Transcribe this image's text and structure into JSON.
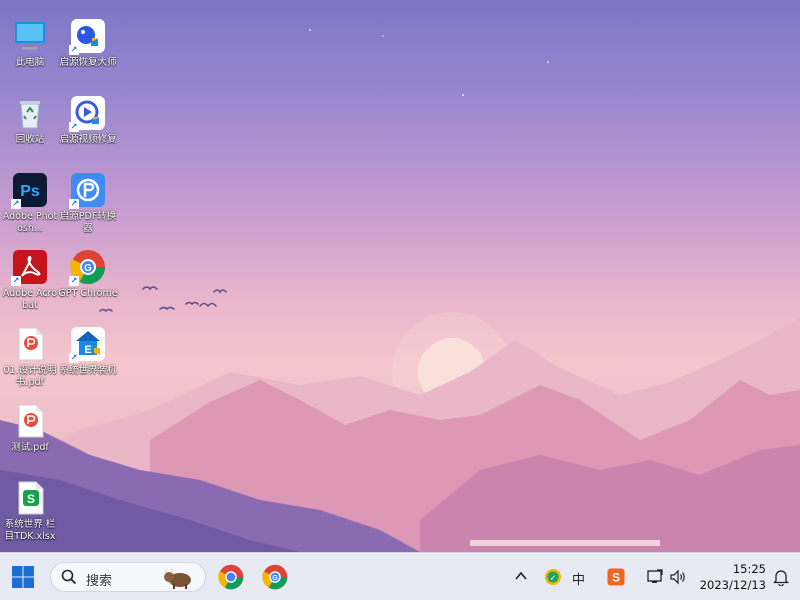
{
  "desktop": {
    "icons": [
      {
        "label": "此电脑"
      },
      {
        "label": "启源恢复大师"
      },
      {
        "label": "回收站"
      },
      {
        "label": "启源视频修复"
      },
      {
        "label": "Adobe Photosh..."
      },
      {
        "label": "启源PDF转换器"
      },
      {
        "label": "Adobe Acrobat"
      },
      {
        "label": "GPT Chrome"
      },
      {
        "label": "01.设计说明书.pdf"
      },
      {
        "label": "系统世界装机"
      },
      {
        "label": "测试.pdf"
      },
      {
        "label": "系统世界 栏目TDK.xlsx"
      }
    ]
  },
  "taskbar": {
    "search": {
      "placeholder": "搜索"
    },
    "tray": {
      "ime": "中"
    },
    "clock": {
      "time": "15:25",
      "date": "2023/12/13"
    }
  },
  "colors": {
    "taskbar_bg": "#e7e9f3",
    "accent": "#1a6fd6"
  }
}
